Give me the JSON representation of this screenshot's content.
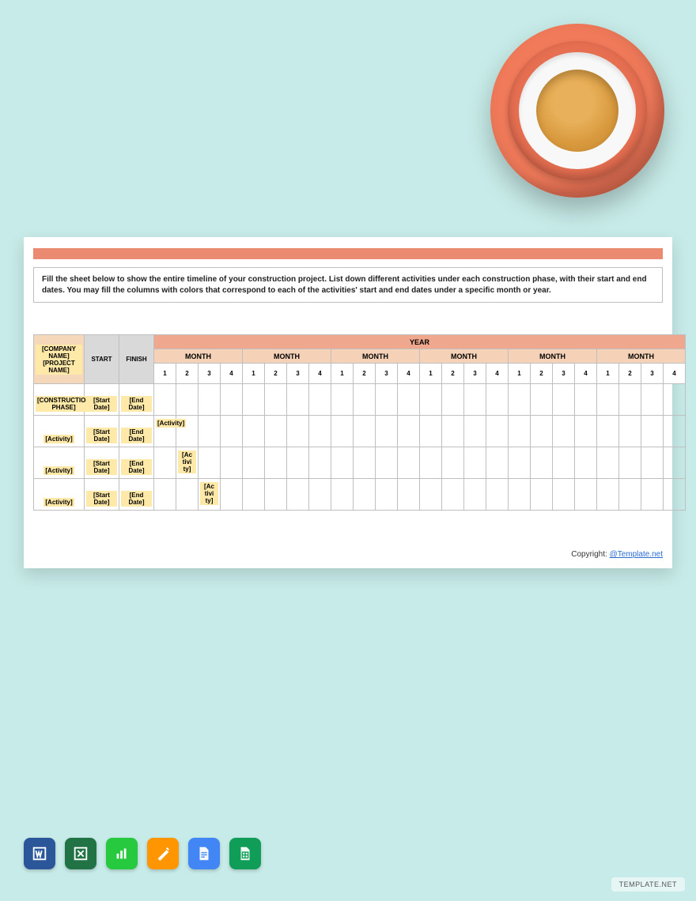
{
  "instruction": "Fill the sheet below to show the entire timeline of your construction project. List down different activities under each construction phase, with their start and end dates. You may fill the columns with colors that correspond to each of the activities' start and end dates under a specific month or year.",
  "header": {
    "company_project": "[COMPANY NAME] [PROJECT NAME]",
    "start": "START",
    "finish": "FINISH",
    "year": "YEAR",
    "month": "MONTH",
    "weeks": [
      "1",
      "2",
      "3",
      "4"
    ]
  },
  "rows": [
    {
      "label": "[CONSTRUCTION PHASE]",
      "start": "[Start Date]",
      "end": "[End Date]",
      "activity_col": null,
      "activity_text": ""
    },
    {
      "label": "[Activity]",
      "start": "[Start Date]",
      "end": "[End Date]",
      "activity_col": 0,
      "activity_text": "[Activity]"
    },
    {
      "label": "[Activity]",
      "start": "[Start Date]",
      "end": "[End Date]",
      "activity_col": 1,
      "activity_text": "[Ac tivi ty]"
    },
    {
      "label": "[Activity]",
      "start": "[Start Date]",
      "end": "[End Date]",
      "activity_col": 2,
      "activity_text": "[Ac tivi ty]"
    }
  ],
  "months_count": 6,
  "copyright_label": "Copyright: ",
  "copyright_link": "@Template.net",
  "watermark": "TEMPLATE.NET",
  "apps": [
    "word",
    "excel",
    "numbers",
    "pages",
    "gdocs",
    "gsheets"
  ]
}
